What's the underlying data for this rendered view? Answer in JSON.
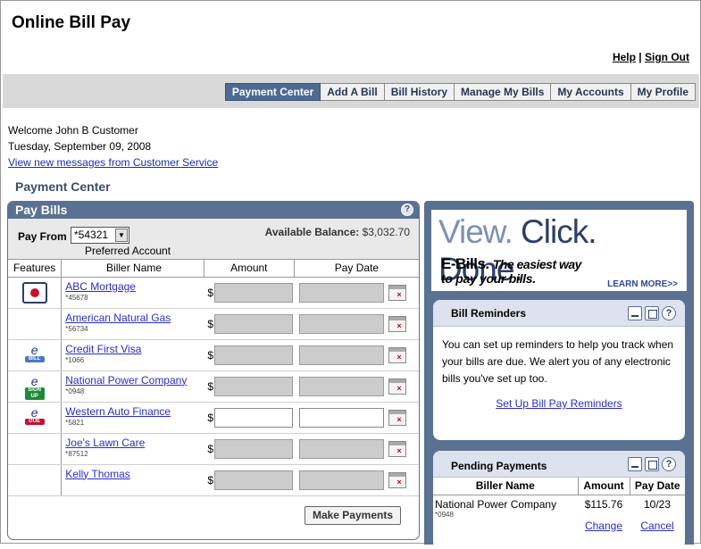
{
  "app_title": "Online Bill Pay",
  "top_links": {
    "help": "Help",
    "separator": "|",
    "signout": "Sign Out"
  },
  "tabs": [
    "Payment Center",
    "Add A Bill",
    "Bill History",
    "Manage My Bills",
    "My Accounts",
    "My Profile"
  ],
  "active_tab": "Payment Center",
  "welcome": {
    "greeting": "Welcome John B Customer",
    "date": "Tuesday, September 09, 2008",
    "messages_link": "View new messages from Customer Service"
  },
  "page_heading": "Payment Center",
  "pay_bills": {
    "title": "Pay Bills",
    "help": "?",
    "pay_from_label": "Pay From",
    "pay_from_value": "*54321",
    "preferred_label": "Preferred Account",
    "balance_label": "Available Balance:",
    "balance_value": "$3,032.70",
    "columns": [
      "Features",
      "Biller Name",
      "Amount",
      "Pay Date"
    ],
    "currency": "$",
    "rows": [
      {
        "name": "ABC Mortgage",
        "account": "*45678",
        "feature": "mortgage-icon",
        "active": false
      },
      {
        "name": "American Natural Gas",
        "account": "*56734",
        "feature": "",
        "active": false
      },
      {
        "name": "Credit First Visa",
        "account": "*1066",
        "feature": "ebill-icon",
        "badge": "BILL",
        "active": false
      },
      {
        "name": "National Power Company",
        "account": "*0948",
        "feature": "ebill-signup-icon",
        "badge": "SIGN UP",
        "active": false
      },
      {
        "name": "Western Auto Finance",
        "account": "*5821",
        "feature": "ebill-due-icon",
        "badge": "DUE",
        "active": true
      },
      {
        "name": "Joe's Lawn Care",
        "account": "*87512",
        "feature": "",
        "active": false
      },
      {
        "name": "Kelly Thomas",
        "account": "",
        "feature": "",
        "active": false
      }
    ],
    "submit_label": "Make Payments"
  },
  "ad": {
    "headline_view": "View.",
    "headline_click": " Click.",
    "headline_done": " Done.",
    "ebills": "E-Bills.",
    "tagline_1": "The easiest way",
    "tagline_2": "to pay your bills.",
    "learn_more": "LEARN MORE>>"
  },
  "bill_reminders": {
    "title": "Bill Reminders",
    "text": "You can set up reminders to help you track when your bills are due. We alert you of any electronic bills you've set up too.",
    "link": "Set Up Bill Pay Reminders"
  },
  "pending": {
    "title": "Pending Payments",
    "columns": [
      "Biller Name",
      "Amount",
      "Pay Date"
    ],
    "rows": [
      {
        "name": "National Power Company",
        "account": "*0948",
        "amount": "$115.76",
        "date": "10/23",
        "change": "Change",
        "cancel": "Cancel"
      }
    ]
  },
  "colors": {
    "panel_blue": "#5b7192",
    "active_tab": "#4d6a92",
    "link": "#2a2ec2",
    "due_badge": "#c8102e",
    "signup_badge": "#1f8a3b"
  }
}
